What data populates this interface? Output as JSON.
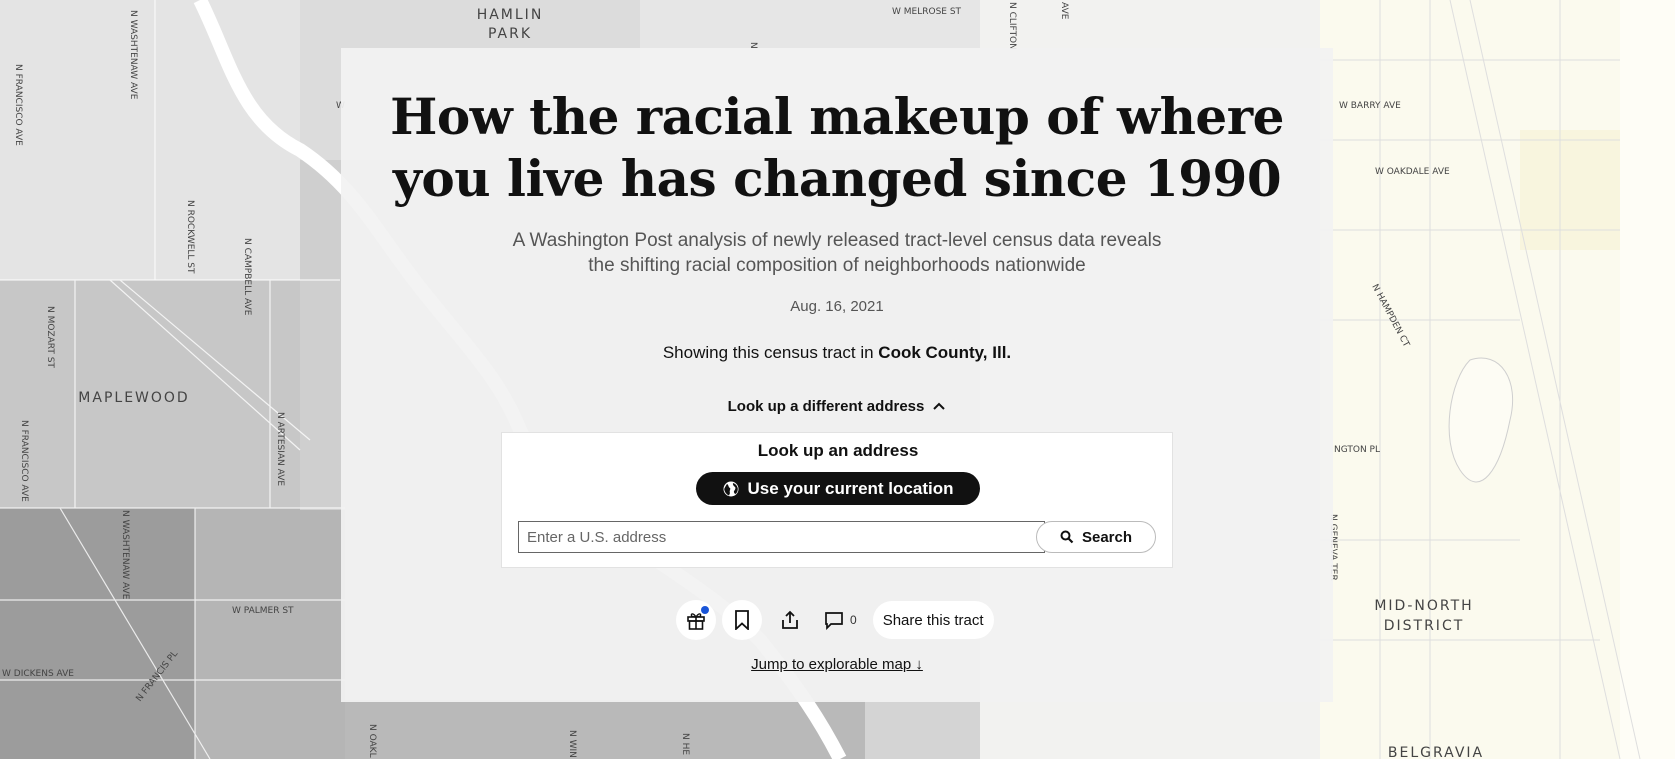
{
  "map": {
    "neighborhoods": [
      "HAMLIN",
      "PARK",
      "MAPLEWOOD",
      "MID-NORTH",
      "DISTRICT",
      "BELGRAVIA"
    ],
    "streets": [
      "W MELROSE ST",
      "N CLIFTON",
      "AVE",
      "N WASHTENAW AVE",
      "N FRANCISCO AVE",
      "W BARRY AVE",
      "W OAKDALE AVE",
      "N ROCKWELL ST",
      "N CAMPBELL AVE",
      "N MOZART ST",
      "N HAMPDEN CT",
      "N ARTESIAN AVE",
      "N FRANCISCO AVE",
      "NGTON PL",
      "N WASHTENAW AVE",
      "W PALMER ST",
      "N FRANCIS PL",
      "W DICKENS AVE",
      "N GENEVA TER",
      "N OAKL",
      "N WIN",
      "N HE",
      "W",
      "N"
    ]
  },
  "article": {
    "title_line1": "How the racial makeup of where",
    "title_line2": "you live has changed since 1990",
    "subtitle_line1": "A Washington Post analysis of newly released tract-level census data reveals",
    "subtitle_line2": "the shifting racial composition of neighborhoods nationwide",
    "date": "Aug. 16, 2021",
    "showing_prefix": "Showing this census tract in",
    "location": "Cook County, Ill."
  },
  "lookup": {
    "toggle_label": "Look up a different address",
    "title": "Look up an address",
    "location_button": "Use your current location",
    "input_placeholder": "Enter a U.S. address",
    "search_button": "Search"
  },
  "actions": {
    "comment_count": "0",
    "share_tract": "Share this tract",
    "jump_link": "Jump to explorable map ↓"
  },
  "colors": {
    "accent_dot": "#1955d8",
    "button_dark": "#111111"
  }
}
